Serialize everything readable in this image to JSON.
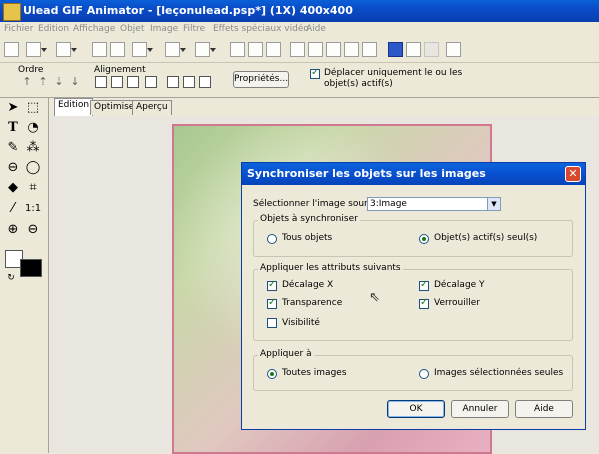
{
  "window": {
    "title": "Ulead GIF Animator - [leçonulead.psp*] (1X) 400x400"
  },
  "menu": [
    "Fichier",
    "Edition",
    "Affichage",
    "Objet",
    "Image",
    "Filtre",
    "Effets spéciaux vidéo",
    "Aide"
  ],
  "toolbar2": {
    "ordre_label": "Ordre",
    "alignement_label": "Alignement",
    "proprietes_button": "Propriétés...",
    "deplacer_label_1": "Déplacer uniquement le ou les",
    "deplacer_label_2": "objet(s) actif(s)",
    "deplacer_checked": true
  },
  "tabs": [
    "Edition",
    "Optimiser",
    "Aperçu"
  ],
  "dialog": {
    "title": "Synchroniser les objets sur les images",
    "close_glyph": "✕",
    "source_label": "Sélectionner l'image source",
    "source_value": "3:Image",
    "group1": {
      "label": "Objets à synchroniser",
      "opt_all": "Tous objets",
      "opt_active": "Objet(s) actif(s) seul(s)",
      "selected": "active"
    },
    "group2": {
      "label": "Appliquer les attributs suivants",
      "decalage_x": "Décalage X",
      "decalage_y": "Décalage Y",
      "transparence": "Transparence",
      "verrouiller": "Verrouiller",
      "visibilite": "Visibilité",
      "checked": {
        "decalage_x": true,
        "decalage_y": true,
        "transparence": true,
        "verrouiller": true,
        "visibilite": false
      }
    },
    "group3": {
      "label": "Appliquer à",
      "opt_all": "Toutes images",
      "opt_selected": "Images sélectionnées seules",
      "selected": "all"
    },
    "buttons": {
      "ok": "OK",
      "cancel": "Annuler",
      "help": "Aide"
    }
  },
  "colors": {
    "titlebar": "#0a4cc8",
    "canvas_border": "#d07890",
    "close_button": "#d8482c"
  }
}
